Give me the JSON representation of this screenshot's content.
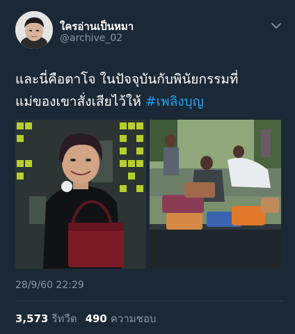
{
  "user": {
    "display_name": "ใครอ่านเป็นหมา",
    "handle": "@archive_02"
  },
  "tweet": {
    "line1": "และนี่คือตาโจ ในปัจจุบันกับพินัยกรรมที่",
    "line2": "แม่ของเขาสั่งเสียไว้ให้ ",
    "hashtag": "#เพลิงบุญ",
    "timestamp": "28/9/60 22:29"
  },
  "stats": {
    "retweets_count": "3,573",
    "retweets_label": "รีทวีต",
    "likes_count": "490",
    "likes_label": "ความชอบ"
  },
  "colors": {
    "background": "#1b2836",
    "link": "#1da1f2",
    "secondary_text": "#8899a6",
    "divider": "#38444d"
  },
  "icons": [
    "chevron-down-icon"
  ]
}
